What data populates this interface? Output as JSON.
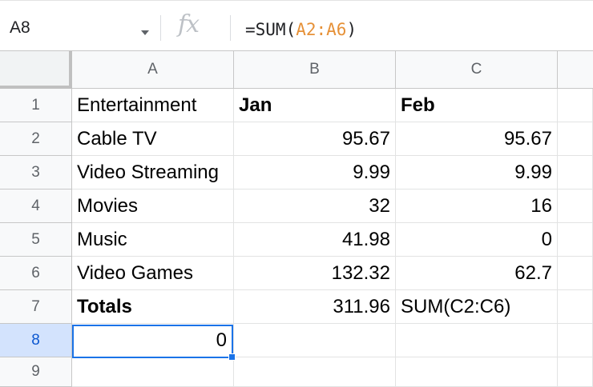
{
  "formula_bar": {
    "cell_ref": "A8",
    "fx_label": "fx",
    "formula_prefix": "=SUM(",
    "formula_ref": "A2:A6",
    "formula_suffix": ")"
  },
  "columns": [
    "A",
    "B",
    "C"
  ],
  "rows": [
    {
      "num": "1",
      "cells": [
        "Entertainment",
        "Jan",
        "Feb"
      ]
    },
    {
      "num": "2",
      "cells": [
        "Cable TV",
        "95.67",
        "95.67"
      ]
    },
    {
      "num": "3",
      "cells": [
        "Video Streaming",
        "9.99",
        "9.99"
      ]
    },
    {
      "num": "4",
      "cells": [
        "Movies",
        "32",
        "16"
      ]
    },
    {
      "num": "5",
      "cells": [
        "Music",
        "41.98",
        "0"
      ]
    },
    {
      "num": "6",
      "cells": [
        "Video Games",
        "132.32",
        "62.7"
      ]
    },
    {
      "num": "7",
      "cells": [
        "Totals",
        "311.96",
        "SUM(C2:C6)"
      ]
    },
    {
      "num": "8",
      "cells": [
        "0",
        "",
        ""
      ]
    },
    {
      "num": "9",
      "cells": [
        "",
        "",
        ""
      ]
    }
  ],
  "colors": {
    "selection": "#1a73e8",
    "formula_ref": "#e69138",
    "header_selected": "#d3e3fd"
  }
}
